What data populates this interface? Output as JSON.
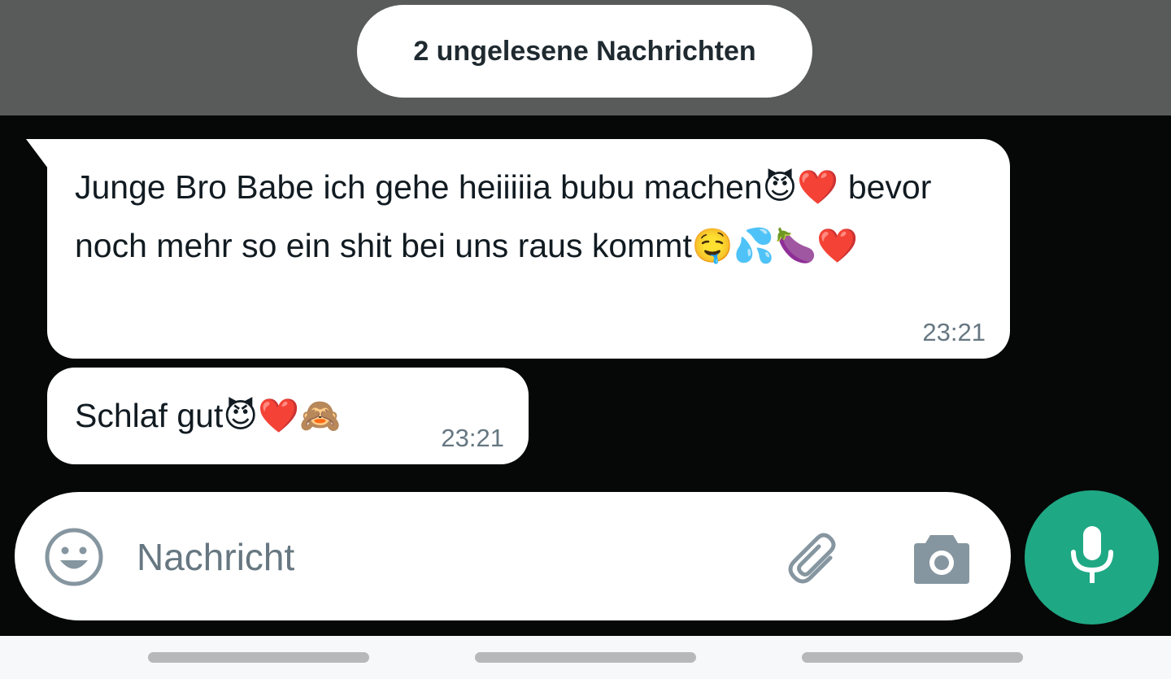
{
  "unread_banner": {
    "label": "2 ungelesene Nachrichten"
  },
  "messages": [
    {
      "text": "Junge Bro Babe ich gehe heiiiiia bubu machen😈❤️ bevor noch mehr so ein shit bei uns raus kommt🤤💦🍆❤️",
      "time": "23:21"
    },
    {
      "text": "Schlaf gut😈❤️🙈",
      "time": "23:21"
    }
  ],
  "composer": {
    "placeholder": "Nachricht",
    "emoji_icon": "smiley-icon",
    "attach_icon": "paperclip-icon",
    "camera_icon": "camera-icon",
    "mic_icon": "microphone-icon"
  },
  "colors": {
    "accent": "#1fa884",
    "bubble": "#ffffff",
    "timestamp": "#667781",
    "icon": "#8696a0"
  }
}
